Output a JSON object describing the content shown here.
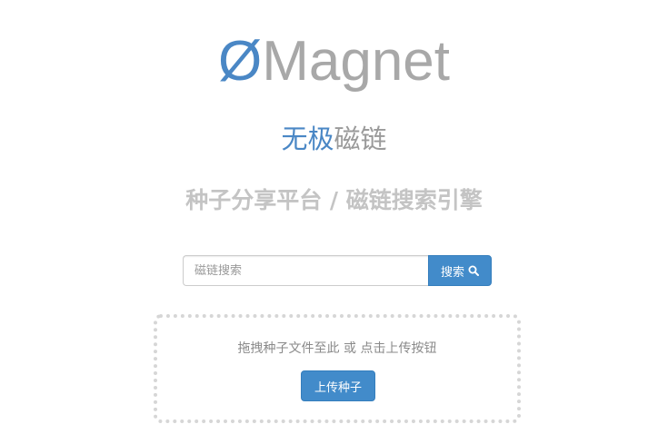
{
  "logo": {
    "mark": "Ø",
    "word": "Magnet"
  },
  "subtitle": {
    "accent": "无极",
    "plain": "磁链"
  },
  "tagline": "种子分享平台 / 磁链搜索引擎",
  "search": {
    "placeholder": "磁链搜索",
    "value": "",
    "button_label": "搜索",
    "icon": "search-icon"
  },
  "upload": {
    "drop_text": "拖拽种子文件至此 或 点击上传按钮",
    "button_label": "上传种子"
  },
  "colors": {
    "accent": "#4a87c5",
    "button": "#428bca",
    "logo_gray": "#a8a8a8",
    "tagline_gray": "#c4c4c4",
    "dropzone_border": "#d6d6d6"
  }
}
